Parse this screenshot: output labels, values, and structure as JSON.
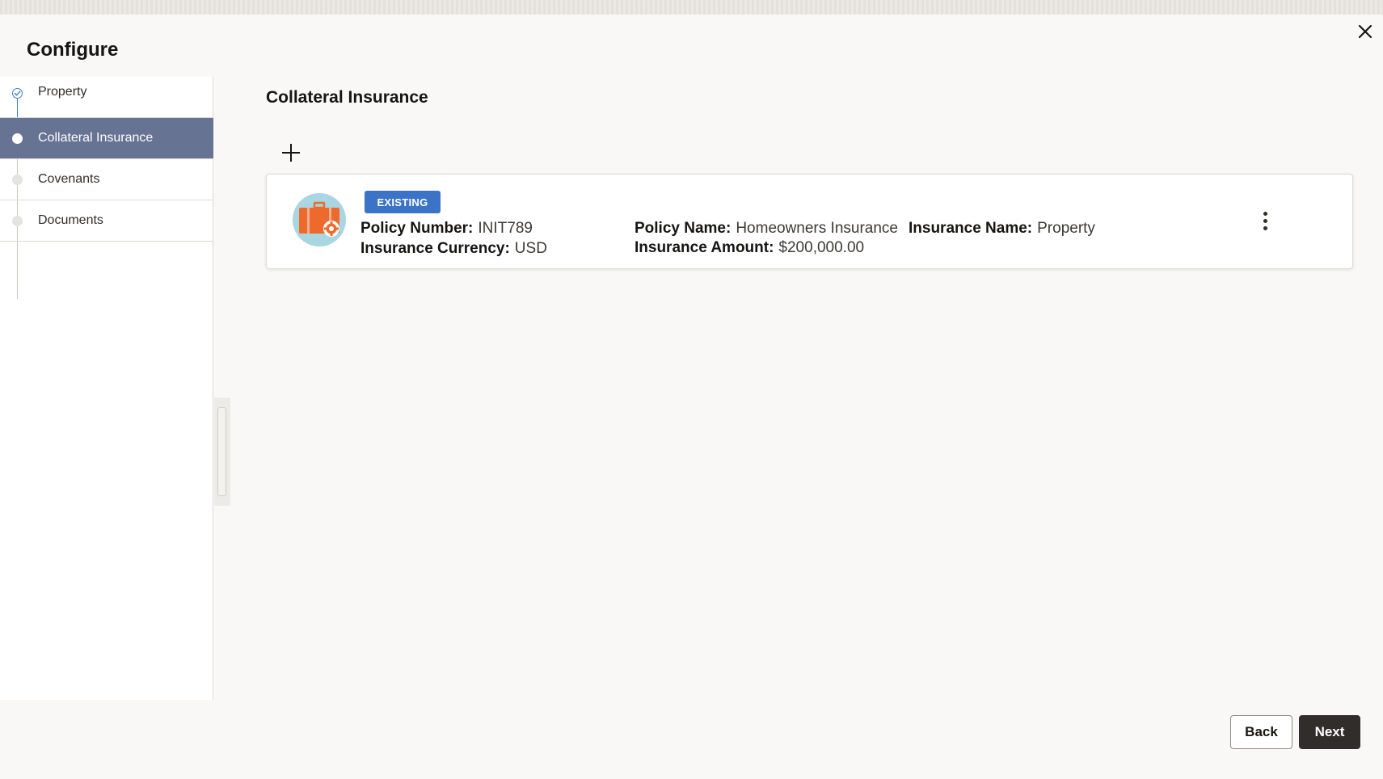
{
  "header": {
    "title": "Configure"
  },
  "steps": [
    {
      "label": "Property",
      "state": "done"
    },
    {
      "label": "Collateral Insurance",
      "state": "active"
    },
    {
      "label": "Covenants",
      "state": "pending"
    },
    {
      "label": "Documents",
      "state": "pending"
    }
  ],
  "main": {
    "section_title": "Collateral Insurance",
    "card": {
      "badge": "EXISTING",
      "policy_number_label": "Policy Number:",
      "policy_number": "INIT789",
      "currency_label": "Insurance Currency:",
      "currency": "USD",
      "policy_name_label": "Policy Name:",
      "policy_name": "Homeowners Insurance",
      "amount_label": "Insurance Amount:",
      "amount": "$200,000.00",
      "insurance_name_label": "Insurance Name:",
      "insurance_name": "Property"
    }
  },
  "footer": {
    "back_label": "Back",
    "next_label": "Next"
  },
  "colors": {
    "accent": "#3b73c7",
    "active_step": "#677393",
    "primary_button": "#312d2a",
    "briefcase": "#ed6a2c",
    "avatar_bg": "#a9d6e0"
  },
  "icons": {
    "close": "close-icon",
    "add": "plus-icon",
    "card": "briefcase-gear-icon",
    "menu": "kebab-menu-icon",
    "done_step": "check-circle-icon"
  }
}
